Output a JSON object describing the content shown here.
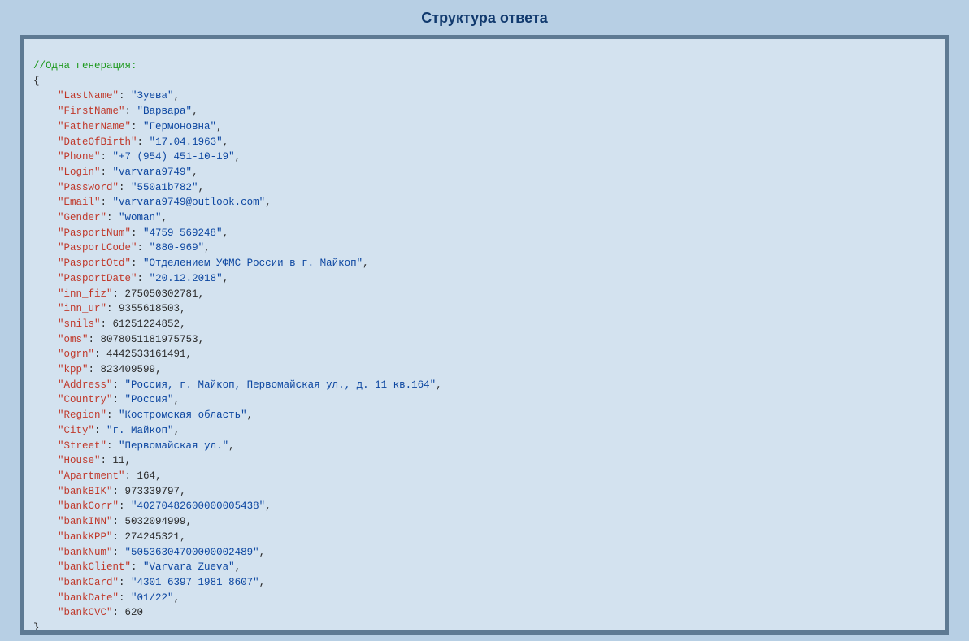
{
  "title": "Структура ответа",
  "comment": "//Одна генерация:",
  "tokens": {
    "lbrace": "{",
    "rbrace": "}",
    "colon": ": ",
    "comma": ",",
    "quote": "\""
  },
  "sample": {
    "LastName": "Зуева",
    "FirstName": "Варвара",
    "FatherName": "Гермоновна",
    "DateOfBirth": "17.04.1963",
    "Phone": "+7 (954) 451-10-19",
    "Login": "varvara9749",
    "Password": "550a1b782",
    "Email": "varvara9749@outlook.com",
    "Gender": "woman",
    "PasportNum": "4759 569248",
    "PasportCode": "880-969",
    "PasportOtd": "Отделением УФМС России в г. Майкоп",
    "PasportDate": "20.12.2018",
    "inn_fiz": "275050302781",
    "inn_ur": "9355618503",
    "snils": "61251224852",
    "oms": "8078051181975753",
    "ogrn": "4442533161491",
    "kpp": "823409599",
    "Address": "Россия, г. Майкоп, Первомайская ул., д. 11 кв.164",
    "Country": "Россия",
    "Region": "Костромская область",
    "City": "г. Майкоп",
    "Street": "Первомайская ул.",
    "House": "11",
    "Apartment": "164",
    "bankBIK": "973339797",
    "bankCorr": "40270482600000005438",
    "bankINN": "5032094999",
    "bankKPP": "274245321",
    "bankNum": "50536304700000002489",
    "bankClient": "Varvara Zueva",
    "bankCard": "4301 6397 1981 8607",
    "bankDate": "01/22",
    "bankCVC": "620"
  },
  "types": {
    "LastName": "string",
    "FirstName": "string",
    "FatherName": "string",
    "DateOfBirth": "string",
    "Phone": "string",
    "Login": "string",
    "Password": "string",
    "Email": "string",
    "Gender": "string",
    "PasportNum": "string",
    "PasportCode": "string",
    "PasportOtd": "string",
    "PasportDate": "string",
    "inn_fiz": "number",
    "inn_ur": "number",
    "snils": "number",
    "oms": "number",
    "ogrn": "number",
    "kpp": "number",
    "Address": "string",
    "Country": "string",
    "Region": "string",
    "City": "string",
    "Street": "string",
    "House": "number",
    "Apartment": "number",
    "bankBIK": "number",
    "bankCorr": "string",
    "bankINN": "number",
    "bankKPP": "number",
    "bankNum": "string",
    "bankClient": "string",
    "bankCard": "string",
    "bankDate": "string",
    "bankCVC": "number"
  },
  "order": [
    "LastName",
    "FirstName",
    "FatherName",
    "DateOfBirth",
    "Phone",
    "Login",
    "Password",
    "Email",
    "Gender",
    "PasportNum",
    "PasportCode",
    "PasportOtd",
    "PasportDate",
    "inn_fiz",
    "inn_ur",
    "snils",
    "oms",
    "ogrn",
    "kpp",
    "Address",
    "Country",
    "Region",
    "City",
    "Street",
    "House",
    "Apartment",
    "bankBIK",
    "bankCorr",
    "bankINN",
    "bankKPP",
    "bankNum",
    "bankClient",
    "bankCard",
    "bankDate",
    "bankCVC"
  ]
}
